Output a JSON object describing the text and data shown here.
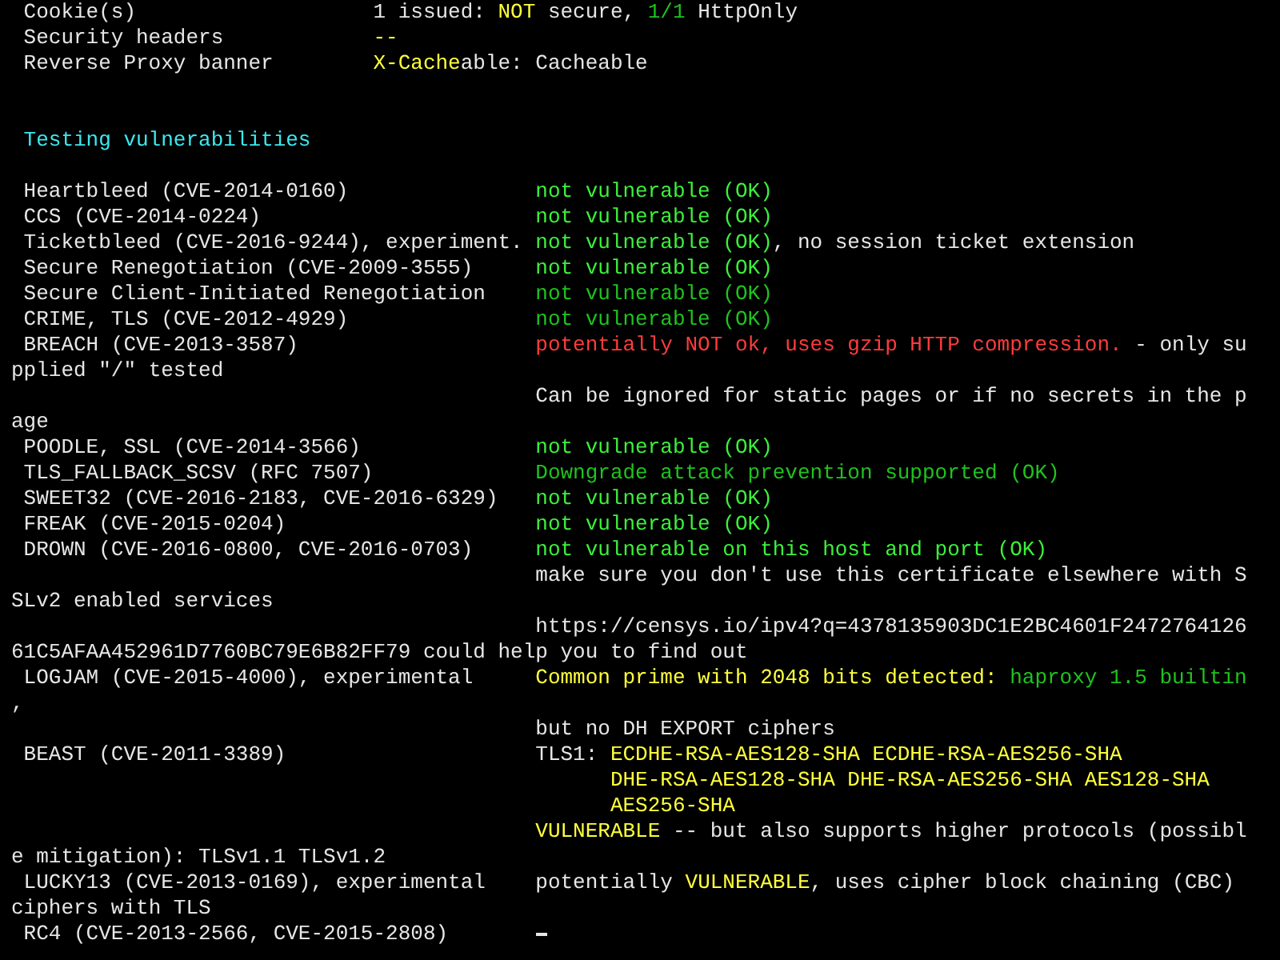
{
  "terminal": {
    "lines": [
      {
        "kind": "field",
        "label": "Cookie(s)",
        "result": [
          {
            "text": "1 issued: ",
            "color": "#e6e6e6"
          },
          {
            "text": "NOT",
            "color": "#ffff3c"
          },
          {
            "text": " secure, ",
            "color": "#e6e6e6"
          },
          {
            "text": "1/1",
            "color": "#1fc31f"
          },
          {
            "text": " HttpOnly",
            "color": "#e6e6e6"
          }
        ]
      },
      {
        "kind": "field",
        "label": "Security headers",
        "result": [
          {
            "text": "--",
            "color": "#ffff3c"
          }
        ]
      },
      {
        "kind": "field",
        "label": "Reverse Proxy banner",
        "result": [
          {
            "text": "X-Cache",
            "color": "#ffff3c"
          },
          {
            "text": "able: Cacheable",
            "color": "#e6e6e6"
          }
        ]
      },
      {
        "kind": "blank"
      },
      {
        "kind": "blank"
      },
      {
        "kind": "heading",
        "label": "Testing vulnerabilities"
      },
      {
        "kind": "blank"
      },
      {
        "kind": "test",
        "label": "Heartbleed (CVE-2014-0160)",
        "result": [
          {
            "text": "not vulnerable (OK)",
            "color": "#3cf03c"
          }
        ]
      },
      {
        "kind": "test",
        "label": "CCS (CVE-2014-0224)",
        "result": [
          {
            "text": "not vulnerable (OK)",
            "color": "#3cf03c"
          }
        ]
      },
      {
        "kind": "test",
        "label": "Ticketbleed (CVE-2016-9244), experiment.",
        "result": [
          {
            "text": "not vulnerable (OK)",
            "color": "#3cf03c"
          },
          {
            "text": ", no session ticket extension",
            "color": "#e6e6e6"
          }
        ]
      },
      {
        "kind": "test",
        "label": "Secure Renegotiation (CVE-2009-3555)",
        "result": [
          {
            "text": "not vulnerable (OK)",
            "color": "#3cf03c"
          }
        ]
      },
      {
        "kind": "test",
        "label": "Secure Client-Initiated Renegotiation",
        "result": [
          {
            "text": "not vulnerable (OK)",
            "color": "#1fc31f"
          }
        ]
      },
      {
        "kind": "test",
        "label": "CRIME, TLS (CVE-2012-4929)",
        "result": [
          {
            "text": "not vulnerable (OK)",
            "color": "#1fc31f"
          }
        ]
      },
      {
        "kind": "test",
        "label": "BREACH (CVE-2013-3587)",
        "result": [
          {
            "text": "potentially NOT ok, uses gzip HTTP compression.",
            "color": "#ff3c3c"
          },
          {
            "text": " - only su",
            "color": "#e6e6e6"
          }
        ]
      },
      {
        "kind": "continuation",
        "label": "pplied \"/\" tested"
      },
      {
        "kind": "result",
        "result": [
          {
            "text": "Can be ignored for static pages or if no secrets in the p",
            "color": "#e6e6e6"
          }
        ]
      },
      {
        "kind": "continuation",
        "label": "age"
      },
      {
        "kind": "test",
        "label": "POODLE, SSL (CVE-2014-3566)",
        "result": [
          {
            "text": "not vulnerable (OK)",
            "color": "#3cf03c"
          }
        ]
      },
      {
        "kind": "test",
        "label": "TLS_FALLBACK_SCSV (RFC 7507)",
        "result": [
          {
            "text": "Downgrade attack prevention supported (OK)",
            "color": "#1fc31f"
          }
        ]
      },
      {
        "kind": "test",
        "label": "SWEET32 (CVE-2016-2183, CVE-2016-6329)",
        "result": [
          {
            "text": "not vulnerable (OK)",
            "color": "#3cf03c"
          }
        ]
      },
      {
        "kind": "test",
        "label": "FREAK (CVE-2015-0204)",
        "result": [
          {
            "text": "not vulnerable (OK)",
            "color": "#3cf03c"
          }
        ]
      },
      {
        "kind": "test",
        "label": "DROWN (CVE-2016-0800, CVE-2016-0703)",
        "result": [
          {
            "text": "not vulnerable on this host and port (OK)",
            "color": "#3cf03c"
          }
        ]
      },
      {
        "kind": "result",
        "result": [
          {
            "text": "make sure you don't use this certificate elsewhere with S",
            "color": "#e6e6e6"
          }
        ]
      },
      {
        "kind": "continuation",
        "label": "SLv2 enabled services"
      },
      {
        "kind": "result",
        "result": [
          {
            "text": "https://censys.io/ipv4?q=4378135903DC1E2BC4601F2472764126",
            "color": "#e6e6e6"
          }
        ]
      },
      {
        "kind": "continuation",
        "label": "61C5AFAA452961D7760BC79E6B82FF79 could help you to find out"
      },
      {
        "kind": "test",
        "label": "LOGJAM (CVE-2015-4000), experimental",
        "result": [
          {
            "text": "Common prime with 2048 bits detected: ",
            "color": "#ffff3c"
          },
          {
            "text": "haproxy 1.5 builtin",
            "color": "#1fc31f"
          }
        ]
      },
      {
        "kind": "continuation",
        "label": ","
      },
      {
        "kind": "result",
        "result": [
          {
            "text": "but no DH EXPORT ciphers",
            "color": "#e6e6e6"
          }
        ]
      },
      {
        "kind": "test",
        "label": "BEAST (CVE-2011-3389)",
        "result": [
          {
            "text": "TLS1: ",
            "color": "#e6e6e6"
          },
          {
            "text": "ECDHE-RSA-AES128-SHA ECDHE-RSA-AES256-SHA",
            "color": "#ffff3c"
          }
        ]
      },
      {
        "kind": "cipher_list",
        "result": [
          {
            "text": "DHE-RSA-AES128-SHA DHE-RSA-AES256-SHA AES128-SHA",
            "color": "#ffff3c"
          }
        ]
      },
      {
        "kind": "cipher_list",
        "result": [
          {
            "text": "AES256-SHA",
            "color": "#ffff3c"
          }
        ]
      },
      {
        "kind": "result",
        "result": [
          {
            "text": "VULNERABLE",
            "color": "#ffff3c"
          },
          {
            "text": " -- but also supports higher protocols (possibl",
            "color": "#e6e6e6"
          }
        ]
      },
      {
        "kind": "continuation",
        "label": "e mitigation): TLSv1.1 TLSv1.2"
      },
      {
        "kind": "test",
        "label": "LUCKY13 (CVE-2013-0169), experimental",
        "result": [
          {
            "text": "potentially ",
            "color": "#e6e6e6"
          },
          {
            "text": "VULNERABLE",
            "color": "#ffff3c"
          },
          {
            "text": ", uses cipher block chaining (CBC)",
            "color": "#e6e6e6"
          }
        ]
      },
      {
        "kind": "continuation",
        "label": "ciphers with TLS"
      },
      {
        "kind": "test",
        "label": "RC4 (CVE-2013-2566, CVE-2015-2808)",
        "cursor": true
      }
    ]
  }
}
